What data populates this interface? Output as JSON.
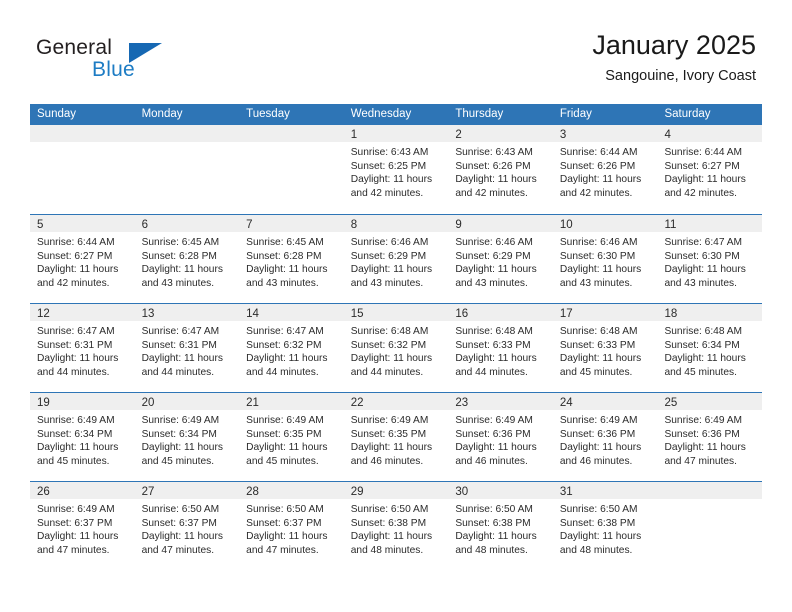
{
  "brand": {
    "word_one": "General",
    "word_two": "Blue",
    "flag_icon": "triangle-flag-icon",
    "accent_color": "#1668b3"
  },
  "header": {
    "title": "January 2025",
    "subtitle": "Sangouine, Ivory Coast"
  },
  "theme": {
    "header_row_color": "#2e75b6",
    "daynum_band_color": "#efefef",
    "text_color": "#2b2b2b"
  },
  "weekdays": [
    "Sunday",
    "Monday",
    "Tuesday",
    "Wednesday",
    "Thursday",
    "Friday",
    "Saturday"
  ],
  "weeks": [
    [
      {
        "day": "",
        "lines": []
      },
      {
        "day": "",
        "lines": []
      },
      {
        "day": "",
        "lines": []
      },
      {
        "day": "1",
        "lines": [
          "Sunrise: 6:43 AM",
          "Sunset: 6:25 PM",
          "Daylight: 11 hours",
          "and 42 minutes."
        ]
      },
      {
        "day": "2",
        "lines": [
          "Sunrise: 6:43 AM",
          "Sunset: 6:26 PM",
          "Daylight: 11 hours",
          "and 42 minutes."
        ]
      },
      {
        "day": "3",
        "lines": [
          "Sunrise: 6:44 AM",
          "Sunset: 6:26 PM",
          "Daylight: 11 hours",
          "and 42 minutes."
        ]
      },
      {
        "day": "4",
        "lines": [
          "Sunrise: 6:44 AM",
          "Sunset: 6:27 PM",
          "Daylight: 11 hours",
          "and 42 minutes."
        ]
      }
    ],
    [
      {
        "day": "5",
        "lines": [
          "Sunrise: 6:44 AM",
          "Sunset: 6:27 PM",
          "Daylight: 11 hours",
          "and 42 minutes."
        ]
      },
      {
        "day": "6",
        "lines": [
          "Sunrise: 6:45 AM",
          "Sunset: 6:28 PM",
          "Daylight: 11 hours",
          "and 43 minutes."
        ]
      },
      {
        "day": "7",
        "lines": [
          "Sunrise: 6:45 AM",
          "Sunset: 6:28 PM",
          "Daylight: 11 hours",
          "and 43 minutes."
        ]
      },
      {
        "day": "8",
        "lines": [
          "Sunrise: 6:46 AM",
          "Sunset: 6:29 PM",
          "Daylight: 11 hours",
          "and 43 minutes."
        ]
      },
      {
        "day": "9",
        "lines": [
          "Sunrise: 6:46 AM",
          "Sunset: 6:29 PM",
          "Daylight: 11 hours",
          "and 43 minutes."
        ]
      },
      {
        "day": "10",
        "lines": [
          "Sunrise: 6:46 AM",
          "Sunset: 6:30 PM",
          "Daylight: 11 hours",
          "and 43 minutes."
        ]
      },
      {
        "day": "11",
        "lines": [
          "Sunrise: 6:47 AM",
          "Sunset: 6:30 PM",
          "Daylight: 11 hours",
          "and 43 minutes."
        ]
      }
    ],
    [
      {
        "day": "12",
        "lines": [
          "Sunrise: 6:47 AM",
          "Sunset: 6:31 PM",
          "Daylight: 11 hours",
          "and 44 minutes."
        ]
      },
      {
        "day": "13",
        "lines": [
          "Sunrise: 6:47 AM",
          "Sunset: 6:31 PM",
          "Daylight: 11 hours",
          "and 44 minutes."
        ]
      },
      {
        "day": "14",
        "lines": [
          "Sunrise: 6:47 AM",
          "Sunset: 6:32 PM",
          "Daylight: 11 hours",
          "and 44 minutes."
        ]
      },
      {
        "day": "15",
        "lines": [
          "Sunrise: 6:48 AM",
          "Sunset: 6:32 PM",
          "Daylight: 11 hours",
          "and 44 minutes."
        ]
      },
      {
        "day": "16",
        "lines": [
          "Sunrise: 6:48 AM",
          "Sunset: 6:33 PM",
          "Daylight: 11 hours",
          "and 44 minutes."
        ]
      },
      {
        "day": "17",
        "lines": [
          "Sunrise: 6:48 AM",
          "Sunset: 6:33 PM",
          "Daylight: 11 hours",
          "and 45 minutes."
        ]
      },
      {
        "day": "18",
        "lines": [
          "Sunrise: 6:48 AM",
          "Sunset: 6:34 PM",
          "Daylight: 11 hours",
          "and 45 minutes."
        ]
      }
    ],
    [
      {
        "day": "19",
        "lines": [
          "Sunrise: 6:49 AM",
          "Sunset: 6:34 PM",
          "Daylight: 11 hours",
          "and 45 minutes."
        ]
      },
      {
        "day": "20",
        "lines": [
          "Sunrise: 6:49 AM",
          "Sunset: 6:34 PM",
          "Daylight: 11 hours",
          "and 45 minutes."
        ]
      },
      {
        "day": "21",
        "lines": [
          "Sunrise: 6:49 AM",
          "Sunset: 6:35 PM",
          "Daylight: 11 hours",
          "and 45 minutes."
        ]
      },
      {
        "day": "22",
        "lines": [
          "Sunrise: 6:49 AM",
          "Sunset: 6:35 PM",
          "Daylight: 11 hours",
          "and 46 minutes."
        ]
      },
      {
        "day": "23",
        "lines": [
          "Sunrise: 6:49 AM",
          "Sunset: 6:36 PM",
          "Daylight: 11 hours",
          "and 46 minutes."
        ]
      },
      {
        "day": "24",
        "lines": [
          "Sunrise: 6:49 AM",
          "Sunset: 6:36 PM",
          "Daylight: 11 hours",
          "and 46 minutes."
        ]
      },
      {
        "day": "25",
        "lines": [
          "Sunrise: 6:49 AM",
          "Sunset: 6:36 PM",
          "Daylight: 11 hours",
          "and 47 minutes."
        ]
      }
    ],
    [
      {
        "day": "26",
        "lines": [
          "Sunrise: 6:49 AM",
          "Sunset: 6:37 PM",
          "Daylight: 11 hours",
          "and 47 minutes."
        ]
      },
      {
        "day": "27",
        "lines": [
          "Sunrise: 6:50 AM",
          "Sunset: 6:37 PM",
          "Daylight: 11 hours",
          "and 47 minutes."
        ]
      },
      {
        "day": "28",
        "lines": [
          "Sunrise: 6:50 AM",
          "Sunset: 6:37 PM",
          "Daylight: 11 hours",
          "and 47 minutes."
        ]
      },
      {
        "day": "29",
        "lines": [
          "Sunrise: 6:50 AM",
          "Sunset: 6:38 PM",
          "Daylight: 11 hours",
          "and 48 minutes."
        ]
      },
      {
        "day": "30",
        "lines": [
          "Sunrise: 6:50 AM",
          "Sunset: 6:38 PM",
          "Daylight: 11 hours",
          "and 48 minutes."
        ]
      },
      {
        "day": "31",
        "lines": [
          "Sunrise: 6:50 AM",
          "Sunset: 6:38 PM",
          "Daylight: 11 hours",
          "and 48 minutes."
        ]
      },
      {
        "day": "",
        "lines": []
      }
    ]
  ]
}
